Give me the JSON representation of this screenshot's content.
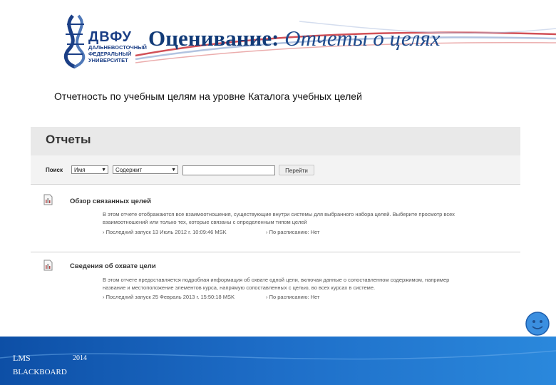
{
  "header": {
    "logo": {
      "abbr": "ДВФУ",
      "line1": "ДАЛЬНЕВОСТОЧНЫЙ",
      "line2": "ФЕДЕРАЛЬНЫЙ",
      "line3": "УНИВЕРСИТЕТ"
    },
    "title_bold": "Оценивание:",
    "title_italic": " Отчеты о целях"
  },
  "subtitle": "Отчетность по учебным целям на уровне Каталога учебных целей",
  "reports_page": {
    "title": "Отчеты",
    "search": {
      "label": "Поиск",
      "field_value": "Имя",
      "operator_value": "Содержит",
      "query_value": "",
      "go_label": "Перейти"
    },
    "reports": [
      {
        "title": "Обзор связанных целей",
        "desc1": "В этом отчете отображаются все взаимоотношения, существующие внутри системы для выбранного набора целей. Выберите просмотр всех",
        "desc2": "взаимоотношений или только тех, которые связаны с определенным типом целей",
        "last_run": "› Последний запуск 13 Июль 2012 г. 10:09:46 MSK",
        "schedule": "› По расписанию: Нет"
      },
      {
        "title": "Сведения об охвате цели",
        "desc1": "В этом отчете предоставляется подробная информация об охвате одной цели, включая данные о сопоставленном содержимом, например",
        "desc2": "название и местоположение элементов курса, напрямую сопоставленных с целью, во всех курсах в системе.",
        "last_run": "› Последний запуск 25 Февраль 2013 г. 15:50:18 MSK",
        "schedule": "› По расписанию: Нет"
      }
    ]
  },
  "footer": {
    "lms": "LMS",
    "year": "2014",
    "blackboard": "BLACKBOARD"
  },
  "colors": {
    "brand_blue": "#1b3f86",
    "band_blue": "#1e6ec8"
  }
}
